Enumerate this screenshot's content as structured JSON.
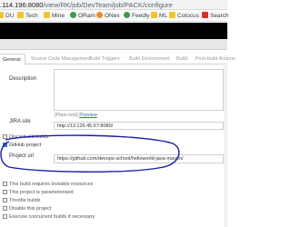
{
  "browser": {
    "url_host": ".114.196:8080",
    "url_path": "/view/RK/job/DevTeam/job/PACK/configure",
    "bookmarks": [
      {
        "label": "DU",
        "icon": "folder-icon"
      },
      {
        "label": "Tech",
        "icon": "folder-icon"
      },
      {
        "label": "Mine",
        "icon": "folder-icon"
      },
      {
        "label": "ORam",
        "icon": "globe-icon"
      },
      {
        "label": "ONex",
        "icon": "globe-icon"
      },
      {
        "label": "Feedly",
        "icon": "feedly-icon"
      },
      {
        "label": "ML",
        "icon": "folder-icon"
      },
      {
        "label": "Cotocus",
        "icon": "folder-icon"
      },
      {
        "label": "Search",
        "icon": "search-engine-icon"
      }
    ]
  },
  "tabs": [
    "General",
    "Source Code Management",
    "Build Triggers",
    "Build Environment",
    "Build",
    "Post-build Actions"
  ],
  "form": {
    "description_label": "Description",
    "description_value": "",
    "plain_text_prefix": "[Plain text]",
    "preview_label": "Preview",
    "jira_label": "JIRA site",
    "jira_value": "http://13.126.45.67:8080/",
    "discard_label": "Discard old builds",
    "github_label": "GitHub project",
    "project_url_label": "Project url",
    "project_url_value": "https://github.com/devops-school/helloworld-java-maven/",
    "options": [
      {
        "label": "This build requires lockable resources",
        "checked": false
      },
      {
        "label": "This project is parameterised",
        "checked": false
      },
      {
        "label": "Throttle builds",
        "checked": false
      },
      {
        "label": "Disable this project",
        "checked": false
      },
      {
        "label": "Execute concurrent builds if necessary",
        "checked": false
      }
    ]
  },
  "colors": {
    "annotation": "#1a1aa8",
    "checkbox_checked": "#3778c6",
    "link": "#2a6db5"
  }
}
